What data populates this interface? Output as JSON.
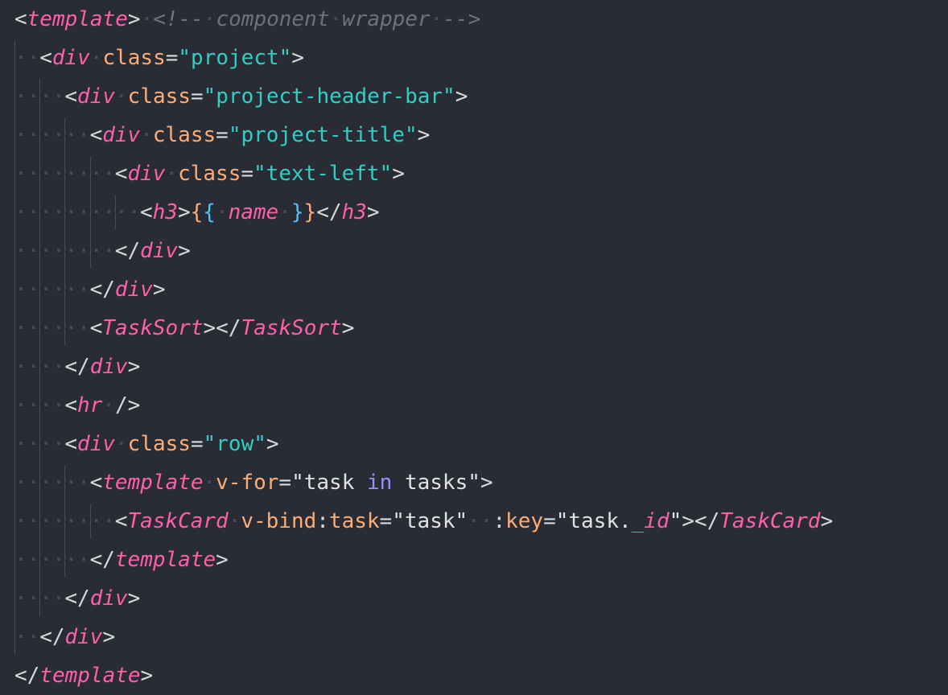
{
  "editor": {
    "language": "vue",
    "colors": {
      "background": "#2a2c35",
      "tag": "#ff5fa8",
      "attribute": "#ffac74",
      "string": "#2fd0c4",
      "comment": "#6f717b",
      "punctuation": "#d9d9d9",
      "keyword": "#9b8cff",
      "brace": "#4fc3f7"
    },
    "lines": [
      {
        "indent": 0,
        "tokens": [
          {
            "t": "<",
            "c": "punct"
          },
          {
            "t": "template",
            "c": "tag"
          },
          {
            "t": ">",
            "c": "punct"
          },
          {
            "t": " ",
            "c": "ws"
          },
          {
            "t": "<!--",
            "c": "comment"
          },
          {
            "t": " ",
            "c": "ws"
          },
          {
            "t": "component",
            "c": "comment"
          },
          {
            "t": " ",
            "c": "ws"
          },
          {
            "t": "wrapper",
            "c": "comment"
          },
          {
            "t": " ",
            "c": "ws"
          },
          {
            "t": "-->",
            "c": "comment"
          }
        ]
      },
      {
        "indent": 1,
        "tokens": [
          {
            "t": "<",
            "c": "punct"
          },
          {
            "t": "div",
            "c": "tag"
          },
          {
            "t": " ",
            "c": "ws"
          },
          {
            "t": "class",
            "c": "attr"
          },
          {
            "t": "=",
            "c": "punct"
          },
          {
            "t": "\"project\"",
            "c": "str"
          },
          {
            "t": ">",
            "c": "punct"
          }
        ]
      },
      {
        "indent": 2,
        "tokens": [
          {
            "t": "<",
            "c": "punct"
          },
          {
            "t": "div",
            "c": "tag"
          },
          {
            "t": " ",
            "c": "ws"
          },
          {
            "t": "class",
            "c": "attr"
          },
          {
            "t": "=",
            "c": "punct"
          },
          {
            "t": "\"project-header-bar\"",
            "c": "str"
          },
          {
            "t": ">",
            "c": "punct"
          }
        ]
      },
      {
        "indent": 3,
        "tokens": [
          {
            "t": "<",
            "c": "punct"
          },
          {
            "t": "div",
            "c": "tag"
          },
          {
            "t": " ",
            "c": "ws"
          },
          {
            "t": "class",
            "c": "attr"
          },
          {
            "t": "=",
            "c": "punct"
          },
          {
            "t": "\"project-title\"",
            "c": "str"
          },
          {
            "t": ">",
            "c": "punct"
          }
        ]
      },
      {
        "indent": 4,
        "tokens": [
          {
            "t": "<",
            "c": "punct"
          },
          {
            "t": "div",
            "c": "tag"
          },
          {
            "t": " ",
            "c": "ws"
          },
          {
            "t": "class",
            "c": "attr"
          },
          {
            "t": "=",
            "c": "punct"
          },
          {
            "t": "\"text-left\"",
            "c": "str"
          },
          {
            "t": ">",
            "c": "punct"
          }
        ]
      },
      {
        "indent": 5,
        "tokens": [
          {
            "t": "<",
            "c": "punct"
          },
          {
            "t": "h3",
            "c": "tag"
          },
          {
            "t": ">",
            "c": "punct"
          },
          {
            "t": "{",
            "c": "brace"
          },
          {
            "t": "{",
            "c": "brace2"
          },
          {
            "t": " ",
            "c": "ws"
          },
          {
            "t": "name",
            "c": "var"
          },
          {
            "t": " ",
            "c": "ws"
          },
          {
            "t": "}",
            "c": "brace2"
          },
          {
            "t": "}",
            "c": "brace"
          },
          {
            "t": "</",
            "c": "punct"
          },
          {
            "t": "h3",
            "c": "tag"
          },
          {
            "t": ">",
            "c": "punct"
          }
        ]
      },
      {
        "indent": 4,
        "tokens": [
          {
            "t": "</",
            "c": "punct"
          },
          {
            "t": "div",
            "c": "tag"
          },
          {
            "t": ">",
            "c": "punct"
          }
        ]
      },
      {
        "indent": 3,
        "tokens": [
          {
            "t": "</",
            "c": "punct"
          },
          {
            "t": "div",
            "c": "tag"
          },
          {
            "t": ">",
            "c": "punct"
          }
        ]
      },
      {
        "indent": 3,
        "tokens": [
          {
            "t": "<",
            "c": "punct"
          },
          {
            "t": "TaskSort",
            "c": "tag"
          },
          {
            "t": "></",
            "c": "punct"
          },
          {
            "t": "TaskSort",
            "c": "tag"
          },
          {
            "t": ">",
            "c": "punct"
          }
        ]
      },
      {
        "indent": 2,
        "tokens": [
          {
            "t": "</",
            "c": "punct"
          },
          {
            "t": "div",
            "c": "tag"
          },
          {
            "t": ">",
            "c": "punct"
          }
        ]
      },
      {
        "indent": 2,
        "tokens": [
          {
            "t": "<",
            "c": "punct"
          },
          {
            "t": "hr",
            "c": "tag"
          },
          {
            "t": " ",
            "c": "ws"
          },
          {
            "t": "/>",
            "c": "punct"
          }
        ]
      },
      {
        "indent": 2,
        "tokens": [
          {
            "t": "<",
            "c": "punct"
          },
          {
            "t": "div",
            "c": "tag"
          },
          {
            "t": " ",
            "c": "ws"
          },
          {
            "t": "class",
            "c": "attr"
          },
          {
            "t": "=",
            "c": "punct"
          },
          {
            "t": "\"row\"",
            "c": "str"
          },
          {
            "t": ">",
            "c": "punct"
          }
        ]
      },
      {
        "indent": 3,
        "tokens": [
          {
            "t": "<",
            "c": "punct"
          },
          {
            "t": "template",
            "c": "tag"
          },
          {
            "t": " ",
            "c": "ws"
          },
          {
            "t": "v-for",
            "c": "attr"
          },
          {
            "t": "=",
            "c": "punct"
          },
          {
            "t": "\"task ",
            "c": "plain"
          },
          {
            "t": "in",
            "c": "kw"
          },
          {
            "t": " tasks\"",
            "c": "plain"
          },
          {
            "t": ">",
            "c": "punct"
          }
        ]
      },
      {
        "indent": 4,
        "tokens": [
          {
            "t": "<",
            "c": "punct"
          },
          {
            "t": "TaskCard",
            "c": "tag"
          },
          {
            "t": " ",
            "c": "ws"
          },
          {
            "t": "v-bind",
            "c": "attr"
          },
          {
            "t": ":",
            "c": "punct"
          },
          {
            "t": "task",
            "c": "attr"
          },
          {
            "t": "=",
            "c": "punct"
          },
          {
            "t": "\"task\"",
            "c": "plain"
          },
          {
            "t": "  ",
            "c": "ws"
          },
          {
            "t": ":",
            "c": "punct"
          },
          {
            "t": "key",
            "c": "attr"
          },
          {
            "t": "=",
            "c": "punct"
          },
          {
            "t": "\"task.",
            "c": "plain"
          },
          {
            "t": "_id",
            "c": "var"
          },
          {
            "t": "\"",
            "c": "plain"
          },
          {
            "t": "></",
            "c": "punct"
          },
          {
            "t": "TaskCard",
            "c": "tag"
          },
          {
            "t": ">",
            "c": "punct"
          }
        ]
      },
      {
        "indent": 3,
        "tokens": [
          {
            "t": "</",
            "c": "punct"
          },
          {
            "t": "template",
            "c": "tag"
          },
          {
            "t": ">",
            "c": "punct"
          }
        ]
      },
      {
        "indent": 2,
        "tokens": [
          {
            "t": "</",
            "c": "punct"
          },
          {
            "t": "div",
            "c": "tag"
          },
          {
            "t": ">",
            "c": "punct"
          }
        ]
      },
      {
        "indent": 1,
        "tokens": [
          {
            "t": "</",
            "c": "punct"
          },
          {
            "t": "div",
            "c": "tag"
          },
          {
            "t": ">",
            "c": "punct"
          }
        ]
      },
      {
        "indent": 0,
        "tokens": [
          {
            "t": "</",
            "c": "punct"
          },
          {
            "t": "template",
            "c": "tag"
          },
          {
            "t": ">",
            "c": "punct"
          }
        ]
      }
    ]
  }
}
